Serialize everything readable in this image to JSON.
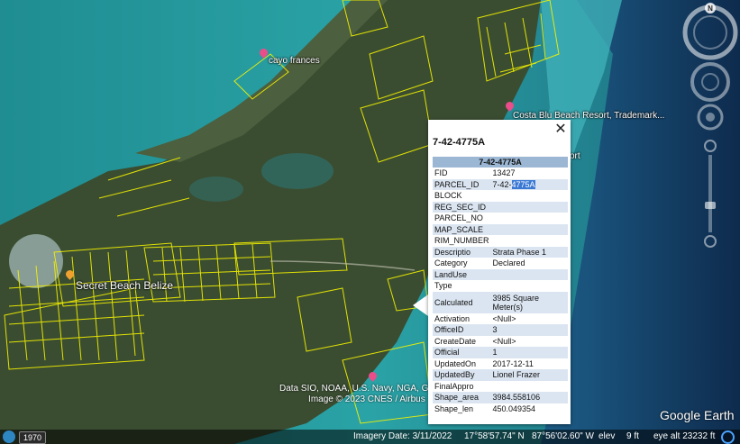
{
  "map": {
    "places": [
      {
        "label": "cayo frances"
      },
      {
        "label": "Costa Blu Beach Resort, Trademark..."
      },
      {
        "label": "Secret Beach Belize"
      },
      {
        "label": "ort"
      }
    ],
    "credits": {
      "line1": "Data SIO, NOAA, U.S. Navy, NGA, GEBCO",
      "line2": "Image © 2023 CNES / Airbus"
    },
    "compass_letter": "N",
    "logo": "Google Earth"
  },
  "popup": {
    "title": "7-42-4775A",
    "table_header": "7-42-4775A",
    "rows": [
      {
        "key": "FID",
        "value": "13427"
      },
      {
        "key": "PARCEL_ID",
        "value": "7-42-4775A",
        "value_plain": "7-42-",
        "value_selected": "4775A"
      },
      {
        "key": "BLOCK",
        "value": ""
      },
      {
        "key": "REG_SEC_ID",
        "value": ""
      },
      {
        "key": "PARCEL_NO",
        "value": ""
      },
      {
        "key": "MAP_SCALE",
        "value": ""
      },
      {
        "key": "RIM_NUMBER",
        "value": ""
      },
      {
        "key": "Descriptio",
        "value": "Strata Phase 1"
      },
      {
        "key": "Category",
        "value": "Declared"
      },
      {
        "key": "LandUse",
        "value": ""
      },
      {
        "key": "Type",
        "value": ""
      },
      {
        "key": "Calculated",
        "value": "3985 Square Meter(s)"
      },
      {
        "key": "Activation",
        "value": "<Null>"
      },
      {
        "key": "OfficeID",
        "value": "3"
      },
      {
        "key": "CreateDate",
        "value": "<Null>"
      },
      {
        "key": "Official",
        "value": "1"
      },
      {
        "key": "UpdatedOn",
        "value": "2017-12-11"
      },
      {
        "key": "UpdatedBy",
        "value": "Lionel Frazer"
      },
      {
        "key": "FinalAppro",
        "value": ""
      },
      {
        "key": "Shape_area",
        "value": "3984.558106"
      },
      {
        "key": "Shape_len",
        "value": "450.049354"
      }
    ],
    "close_glyph": "✕"
  },
  "status": {
    "year": "1970",
    "imagery_date": "Imagery Date: 3/11/2022",
    "lat": "17°58'57.74\" N",
    "lon": "87°56'02.60\" W",
    "elev_label": "elev",
    "elev_value": "9 ft",
    "eye_alt": "eye alt  23232 ft"
  },
  "colors": {
    "parcel_lines": "#f5f200",
    "table_header": "#9bb7d4",
    "row_alt": "#dbe5f1",
    "selection": "#3a78d4"
  }
}
